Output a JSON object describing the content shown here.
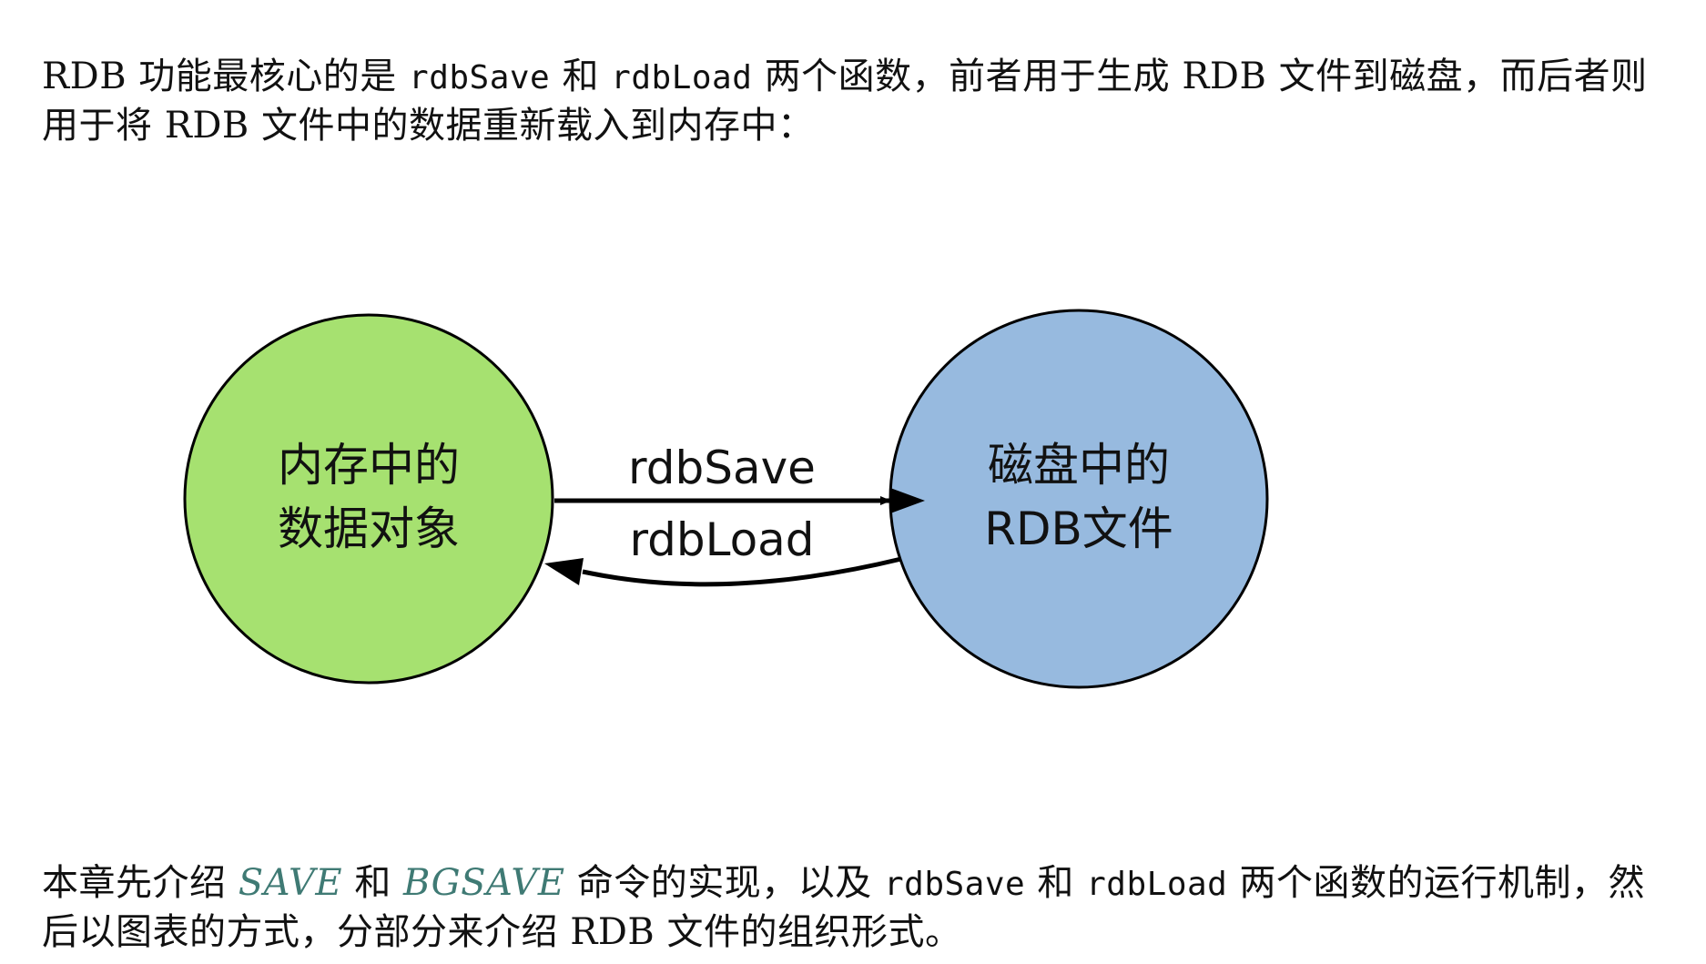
{
  "intro": {
    "t1": "RDB 功能最核心的是 ",
    "code1": "rdbSave",
    "t2": " 和 ",
    "code2": "rdbLoad",
    "t3": " 两个函数，前者用于生成 RDB 文件到磁盘，而后者则用于将 RDB 文件中的数据重新载入到内存中："
  },
  "diagram": {
    "memory_node": {
      "line1": "内存中的",
      "line2": "数据对象",
      "fill": "#a6e170"
    },
    "disk_node": {
      "line1": "磁盘中的",
      "line2": "RDB文件",
      "fill": "#97badf"
    },
    "save_edge_label": "rdbSave",
    "load_edge_label": "rdbLoad"
  },
  "outro": {
    "t1": "本章先介绍 ",
    "cmd1": "SAVE",
    "t2": " 和 ",
    "cmd2": "BGSAVE",
    "t3": " 命令的实现，以及 ",
    "code1": "rdbSave",
    "t4": " 和 ",
    "code2": "rdbLoad",
    "t5": " 两个函数的运行机制，然后以图表的方式，分部分来介绍 RDB 文件的组织形式。"
  }
}
